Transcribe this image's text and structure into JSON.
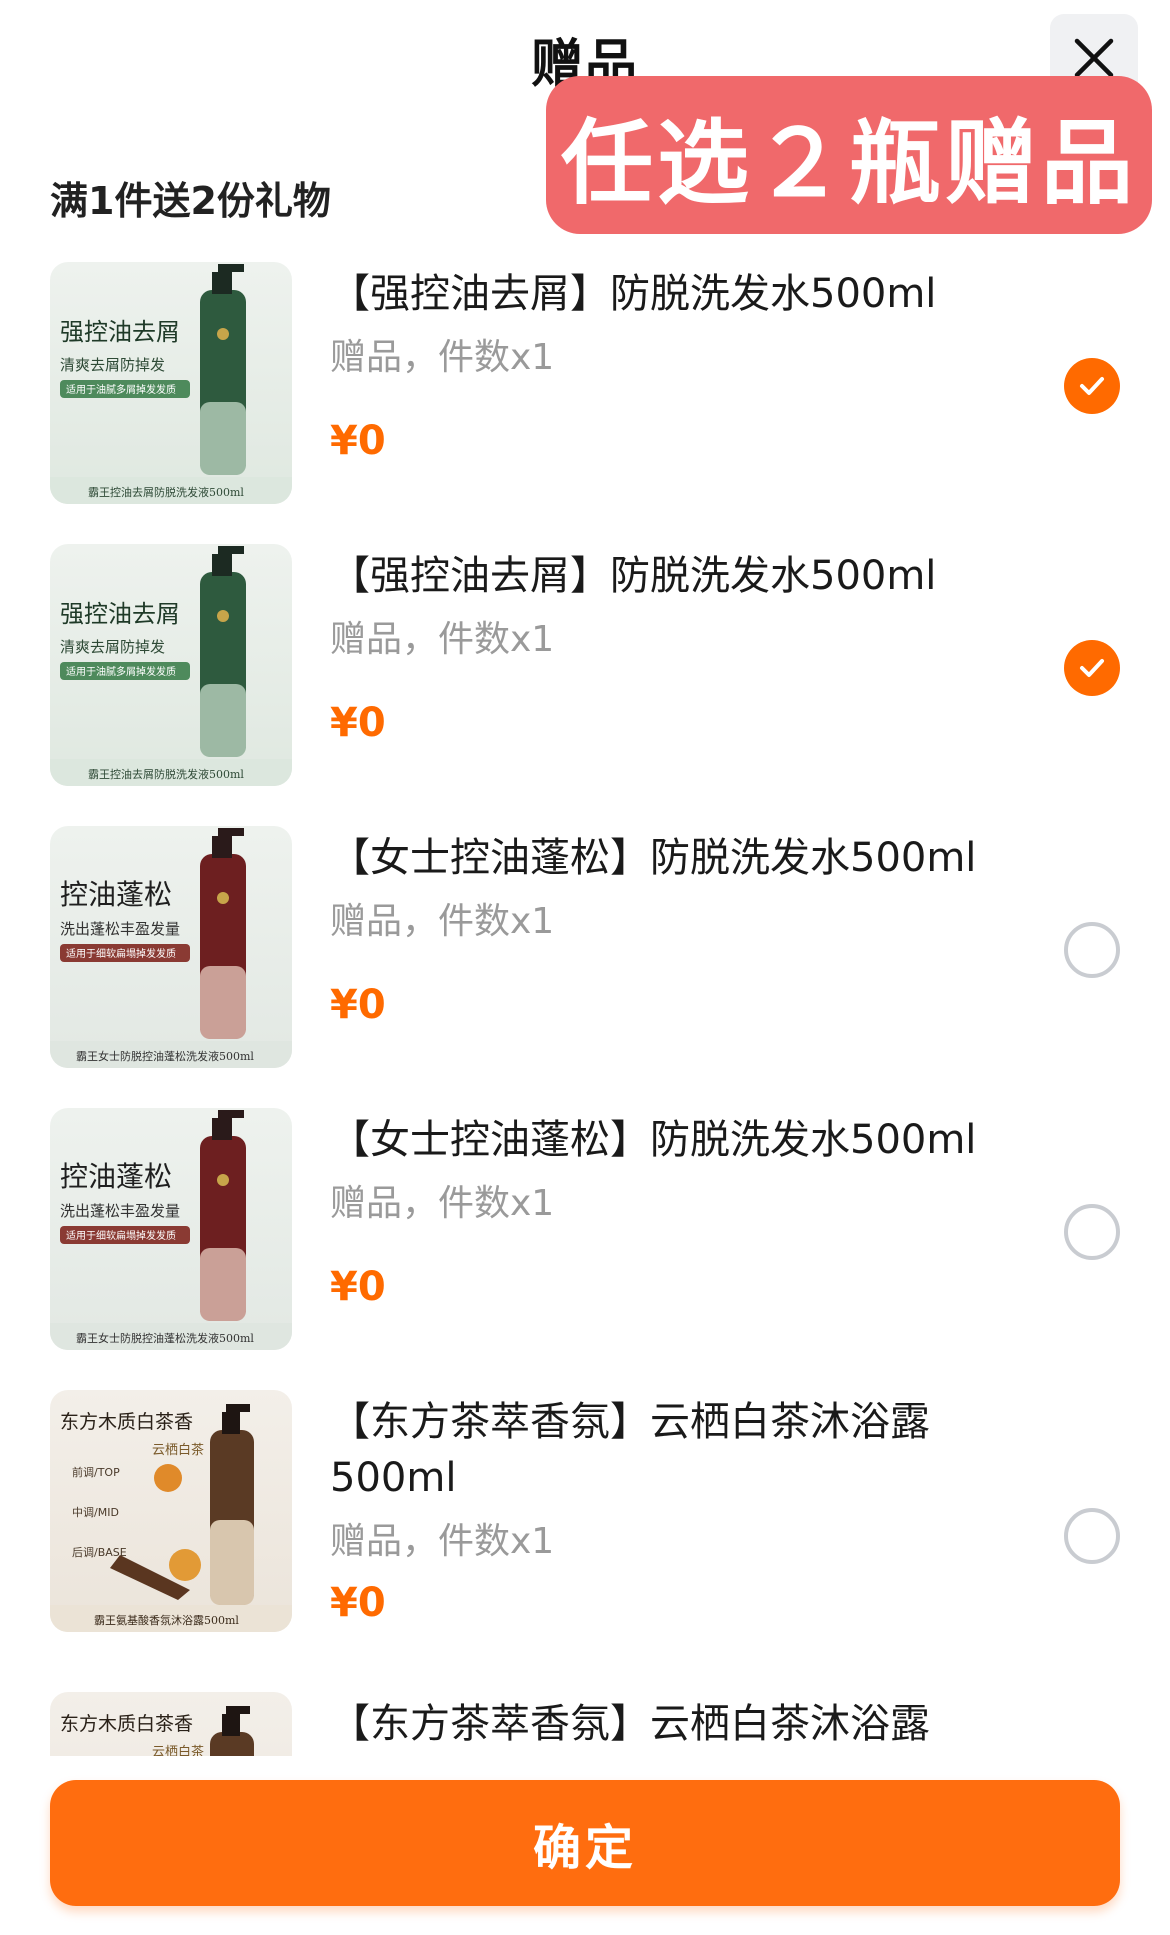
{
  "header": {
    "title": "赠品",
    "close_icon": "close-icon"
  },
  "promo": {
    "text": "任选２瓶赠品"
  },
  "rule": {
    "text": "满1件送2份礼物"
  },
  "colors": {
    "accent": "#ff6a00",
    "promo_bg": "#f0696b",
    "muted": "#9a9a9a"
  },
  "items": [
    {
      "name": "【强控油去屑】防脱洗发水500ml",
      "sub": "赠品，件数x1",
      "price": "¥0",
      "selected": true,
      "thumb": {
        "headline": "强控油去屑",
        "line2": "清爽去屑防掉发",
        "tag": "适用于油腻多屑掉发发质",
        "footer": "霸王控油去屑防脱洗发液500ml"
      }
    },
    {
      "name": "【强控油去屑】防脱洗发水500ml",
      "sub": "赠品，件数x1",
      "price": "¥0",
      "selected": true,
      "thumb": {
        "headline": "强控油去屑",
        "line2": "清爽去屑防掉发",
        "tag": "适用于油腻多屑掉发发质",
        "footer": "霸王控油去屑防脱洗发液500ml"
      }
    },
    {
      "name": "【女士控油蓬松】防脱洗发水500ml",
      "sub": "赠品，件数x1",
      "price": "¥0",
      "selected": false,
      "thumb": {
        "headline": "控油蓬松",
        "line2": "洗出蓬松丰盈发量",
        "tag": "适用于细软扁塌掉发发质",
        "footer": "霸王女士防脱控油蓬松洗发液500ml"
      }
    },
    {
      "name": "【女士控油蓬松】防脱洗发水500ml",
      "sub": "赠品，件数x1",
      "price": "¥0",
      "selected": false,
      "thumb": {
        "headline": "控油蓬松",
        "line2": "洗出蓬松丰盈发量",
        "tag": "适用于细软扁塌掉发发质",
        "footer": "霸王女士防脱控油蓬松洗发液500ml"
      }
    },
    {
      "name": "【东方茶萃香氛】云栖白茶沐浴露500ml",
      "sub": "赠品，件数x1",
      "price": "¥0",
      "selected": false,
      "thumb": {
        "headline": "东方木质白茶香",
        "line2": "云栖白茶",
        "notes": [
          "前调/TOP",
          "中调/MID",
          "后调/BASE"
        ],
        "footer": "霸王氨基酸香氛沐浴露500ml"
      }
    },
    {
      "name": "【东方茶萃香氛】云栖白茶沐浴露",
      "sub": "",
      "price": "",
      "selected": false,
      "thumb": {
        "headline": "东方木质白茶香",
        "line2": "云栖白茶",
        "notes": [],
        "footer": ""
      }
    }
  ],
  "footer": {
    "confirm_label": "确定"
  }
}
